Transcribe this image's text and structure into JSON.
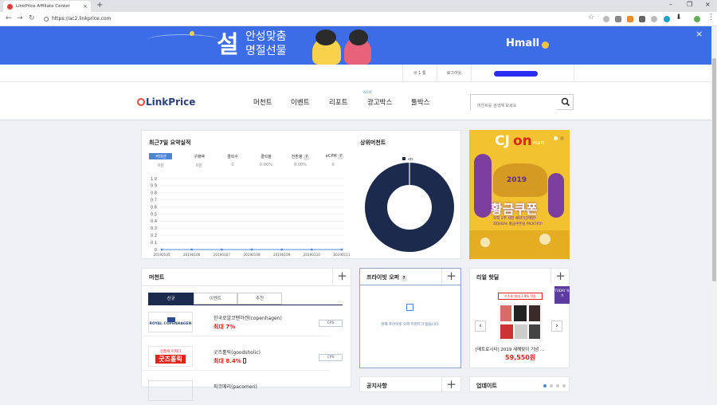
{
  "browser": {
    "tab_title": "LinkPrice Affiliate Center",
    "url": "https://ac2.linkprice.com",
    "new_tab": "+",
    "tab_close": "×",
    "win_minimize": "–",
    "win_restore": "❐",
    "win_close": "×",
    "back": "←",
    "forward": "→",
    "reload": "↻"
  },
  "banner": {
    "big": "설",
    "line1": "안성맞춤",
    "line2": "명절선물",
    "brand": "Hmall",
    "close": "×",
    "colors": {
      "bg": "#3d6de6"
    }
  },
  "util": {
    "mail": "✉ 1 통",
    "logout": "로그아웃"
  },
  "header": {
    "logo": "LinkPrice",
    "menu": [
      "머천트",
      "이벤트",
      "리포트",
      "광고박스",
      "툴박스"
    ],
    "new_tag": "NEW",
    "search_placeholder": "머천트를 검색해 보세요"
  },
  "summary": {
    "title": "최근7일 요약실적",
    "stats": [
      {
        "label": "커미션",
        "value": "0원"
      },
      {
        "label": "구매액",
        "value": "0원"
      },
      {
        "label": "클릭수",
        "value": "0"
      },
      {
        "label": "클릭율",
        "value": "0.00%"
      },
      {
        "label": "전환율",
        "value": "0.00%"
      },
      {
        "label": "eCPM",
        "value": "0"
      }
    ],
    "help": "?"
  },
  "chart_data": [
    {
      "type": "line",
      "x": [
        "20190105",
        "20190106",
        "20190107",
        "20190108",
        "20190109",
        "20190110",
        "20190111"
      ],
      "series": [
        {
          "values": [
            0,
            0,
            0,
            0,
            0,
            0,
            0
          ]
        }
      ],
      "yticks": [
        "0",
        "0.1",
        "0.2",
        "0.3",
        "0.4",
        "0.5",
        "0.6",
        "0.7",
        "0.8",
        "0.9",
        "1.0"
      ],
      "ylim": [
        0,
        1.0
      ],
      "grid": true
    },
    {
      "type": "pie",
      "title": "상위머천트",
      "categories": [
        "etc"
      ],
      "values": [
        100
      ],
      "legend": "top-center",
      "colors": [
        "#1c2b4d"
      ]
    }
  ],
  "merchants": {
    "title": "머천트",
    "plus": "+",
    "tabs": [
      "신규",
      "이벤트",
      "추천"
    ],
    "rows": [
      {
        "logo": "ROYAL COPENHAGEN",
        "name": "한국로얄코펜하겐(copenhagen)",
        "rate": "최대 7%",
        "badge": "CPS"
      },
      {
        "logo": "굿즈홀릭",
        "logo_sub": "상품에 미치다",
        "name": "굿즈홀릭(goodsholic)",
        "rate": "최대 8.4%",
        "badge": "CPS"
      },
      {
        "logo": "",
        "name": "파코메리(pacomeri)",
        "rate": "",
        "badge": ""
      }
    ]
  },
  "private_offer": {
    "title": "프라이빗 오퍼",
    "help": "?",
    "plus": "+",
    "empty": "현재 프라이빗 오퍼 머천트가 없습니다."
  },
  "notice": {
    "title": "공지사항",
    "plus": "+"
  },
  "realtime": {
    "title": "리얼 핫딜",
    "plus": "+",
    "badge": "TODAY 특가",
    "commission": "수수료 최대 1.9% 적용",
    "product": "[메트로시티] 2019 새해맞이 기념 ...",
    "price": "59,550원",
    "prev": "‹",
    "next": "›"
  },
  "update": {
    "title": "업데이트"
  },
  "ad": {
    "brand": "CJ",
    "brand2": "on",
    "brand3": "mart",
    "year": "2019",
    "headline": "황금쿠폰",
    "desc1": "오직 2주 사전 예약가간에만!",
    "desc2": "최대40% 황금쿠폰을 PICK하라!"
  }
}
